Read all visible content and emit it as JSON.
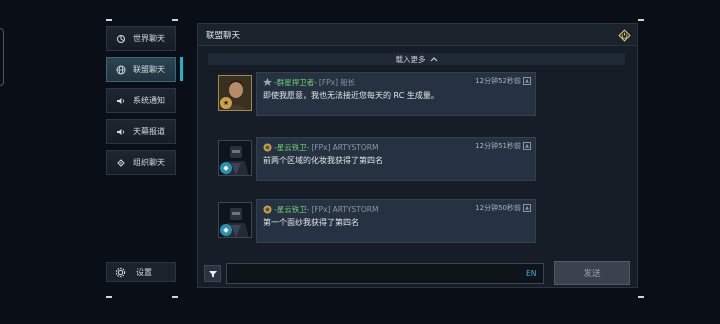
{
  "side_tabs": [
    {
      "label": "世界聊天",
      "icon": "world-chat-icon"
    },
    {
      "label": "联盟聊天",
      "icon": "globe-icon",
      "active": true
    },
    {
      "label": "系统通知",
      "icon": "speaker-icon"
    },
    {
      "label": "天幕报道",
      "icon": "speaker-icon"
    },
    {
      "label": "组织聊天",
      "icon": "link-icon"
    }
  ],
  "settings": {
    "label": "设置",
    "icon": "gear-icon"
  },
  "panel": {
    "title": "联盟聊天",
    "close_icon": "close-power-icon"
  },
  "load_more": "载入更多",
  "messages": [
    {
      "alliance": "-群星捍卫者-",
      "tag": "[FPx]",
      "rank": "船长",
      "time": "12分钟52秒前",
      "text": "即使我愿意，我也无法接近您每天的 RC 生成量。",
      "avatar": "captain-portrait"
    },
    {
      "alliance": "-星云铁卫-",
      "tag": "[FPx]",
      "rank": "ARTYSTORM",
      "time": "12分钟51秒前",
      "text": "前两个区域的化妆我获得了第四名",
      "avatar": "armored-portrait"
    },
    {
      "alliance": "-星云铁卫-",
      "tag": "[FPx]",
      "rank": "ARTYSTORM",
      "time": "12分钟50秒前",
      "text": "第一个面纱我获得了第四名",
      "avatar": "armored-portrait"
    }
  ],
  "input": {
    "value": "",
    "placeholder": "",
    "ime": "EN"
  },
  "send_label": "发送",
  "colors": {
    "accent": "#1fb3c8",
    "alliance_name": "#6fcf73"
  }
}
